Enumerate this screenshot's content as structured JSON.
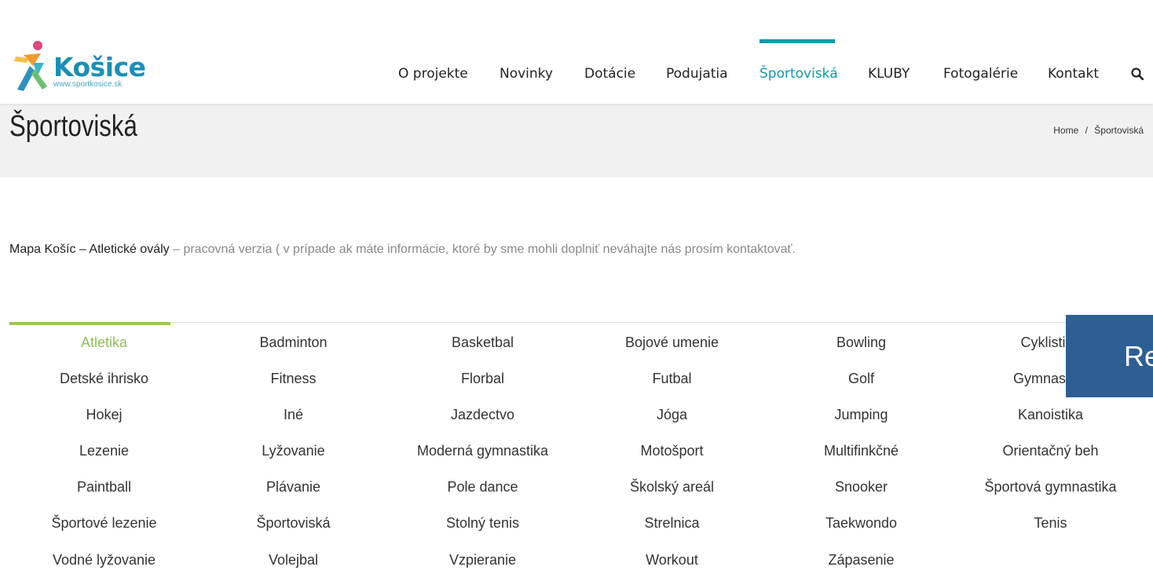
{
  "logo": {
    "title": "Košice",
    "subtitle": "www.sportkosice.sk"
  },
  "nav": {
    "items": [
      {
        "label": "O projekte"
      },
      {
        "label": "Novinky"
      },
      {
        "label": "Dotácie"
      },
      {
        "label": "Podujatia"
      },
      {
        "label": "Športoviská",
        "active": true
      },
      {
        "label": "KLUBY"
      },
      {
        "label": "Fotogalérie"
      },
      {
        "label": "Kontakt"
      }
    ],
    "search_icon": "search-icon",
    "accent_color": "#0f9aa9"
  },
  "page": {
    "title": "Športoviská",
    "breadcrumb": {
      "home": "Home",
      "separator": "/",
      "current": "Športoviská"
    }
  },
  "intro": {
    "lead": "Mapa Košíc – Atletické ovály",
    "rest": " – pracovná verzia ( v prípade ak máte informácie, ktoré by sme mohli doplniť neváhajte nás prosím kontaktovať."
  },
  "tabs": {
    "active_color": "#8dc05a",
    "items": [
      "Atletika",
      "Badminton",
      "Basketbal",
      "Bojové umenie",
      "Bowling",
      "Cyklistika",
      "Detské ihrisko",
      "Fitness",
      "Florbal",
      "Futbal",
      "Golf",
      "Gymnastika",
      "Hokej",
      "Iné",
      "Jazdectvo",
      "Jóga",
      "Jumping",
      "Kanoistika",
      "Lezenie",
      "Lyžovanie",
      "Moderná gymnastika",
      "Motošport",
      "Multifinkčné",
      "Orientačný beh",
      "Paintball",
      "Plávanie",
      "Pole dance",
      "Školský areál",
      "Snooker",
      "Športová gymnastika",
      "Športové lezenie",
      "Športoviská",
      "Stolný tenis",
      "Strelnica",
      "Taekwondo",
      "Tenis",
      "Vodné lyžovanie",
      "Volejbal",
      "Vzpieranie",
      "Workout",
      "Zápasenie"
    ]
  },
  "floating_panel": {
    "text": "Re",
    "color": "#2d5f93"
  }
}
